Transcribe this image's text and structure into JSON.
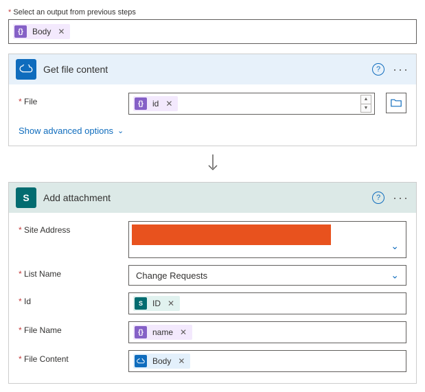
{
  "topField": {
    "label": "Select an output from previous steps",
    "token": {
      "icon": "{}",
      "text": "Body"
    }
  },
  "card1": {
    "title": "Get file content",
    "fields": {
      "file": {
        "label": "File",
        "token": {
          "icon": "{}",
          "text": "id"
        }
      }
    },
    "advancedLink": "Show advanced options"
  },
  "card2": {
    "title": "Add attachment",
    "fields": {
      "siteAddress": {
        "label": "Site Address"
      },
      "listName": {
        "label": "List Name",
        "value": "Change Requests"
      },
      "id": {
        "label": "Id",
        "token": {
          "icon": "S",
          "text": "ID"
        }
      },
      "fileName": {
        "label": "File Name",
        "token": {
          "icon": "{}",
          "text": "name"
        }
      },
      "fileContent": {
        "label": "File Content",
        "token": {
          "icon": "☁",
          "text": "Body"
        }
      }
    }
  }
}
